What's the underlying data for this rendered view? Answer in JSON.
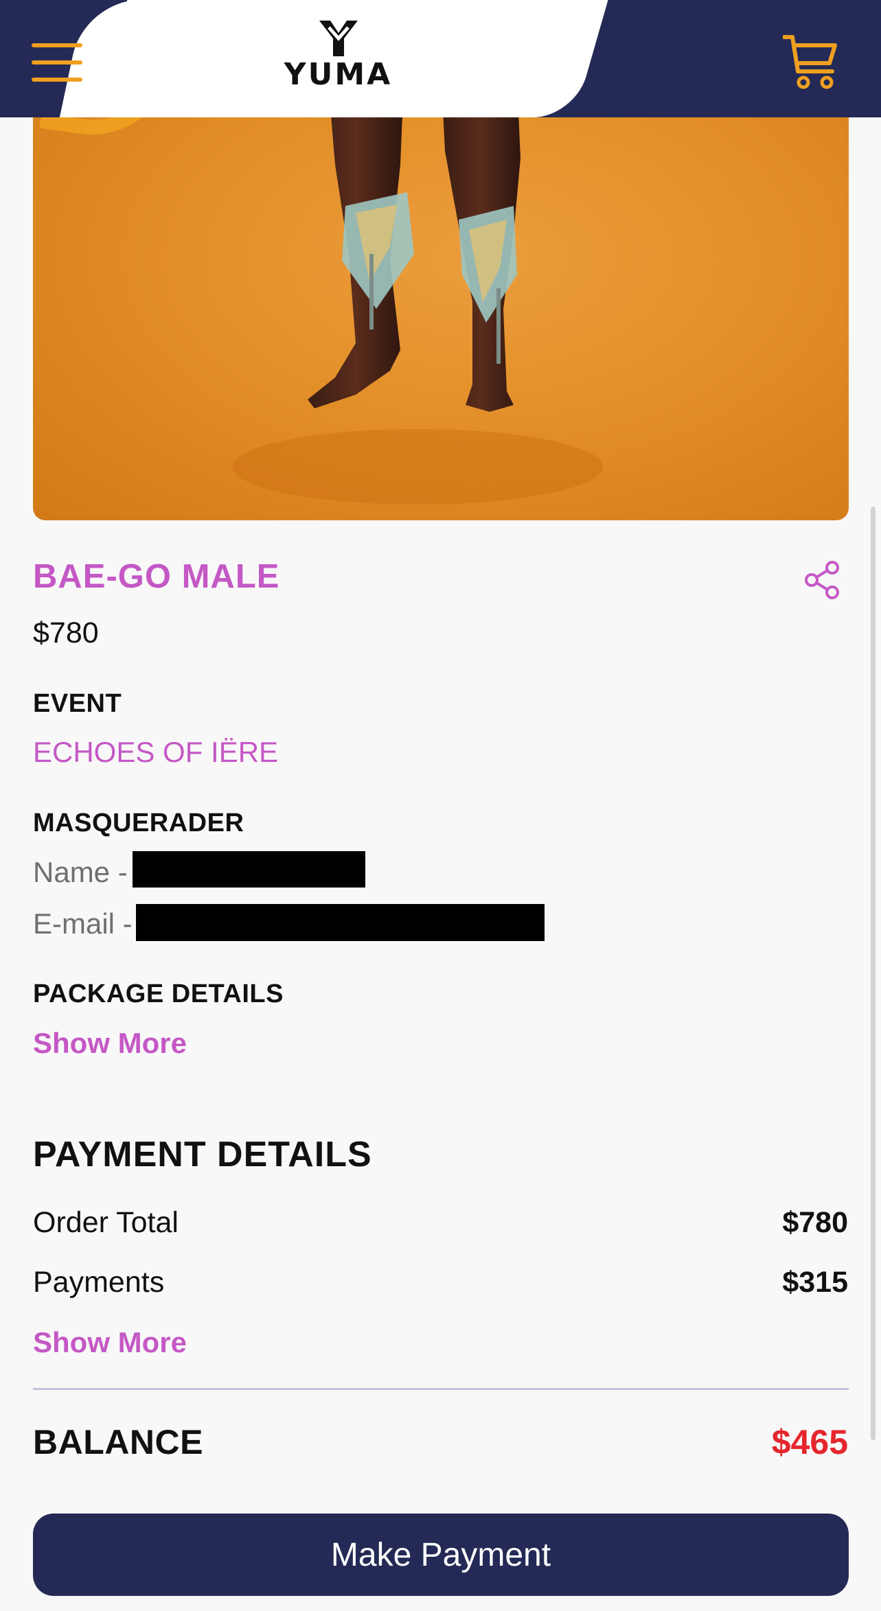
{
  "header": {
    "logo_text": "YUMA",
    "icons": {
      "menu": "hamburger-menu-icon",
      "cart": "shopping-cart-icon"
    }
  },
  "product": {
    "title": "BAE-GO MALE",
    "price": "$780",
    "share_icon": "share-icon"
  },
  "event": {
    "label": "EVENT",
    "name": "ECHOES OF IËRE"
  },
  "masquerader": {
    "label": "MASQUERADER",
    "name_prefix": "Name -",
    "email_prefix": "E-mail -"
  },
  "package": {
    "label": "PACKAGE DETAILS",
    "show_more": "Show More"
  },
  "payment": {
    "heading": "PAYMENT DETAILS",
    "order_total_label": "Order Total",
    "order_total_value": "$780",
    "payments_label": "Payments",
    "payments_value": "$315",
    "show_more": "Show More",
    "balance_label": "BALANCE",
    "balance_value": "$465"
  },
  "actions": {
    "make_payment": "Make Payment"
  },
  "colors": {
    "navy": "#242a55",
    "accent_orange": "#f0a020",
    "accent_purple": "#c458c5",
    "balance_red": "#e5262d"
  }
}
